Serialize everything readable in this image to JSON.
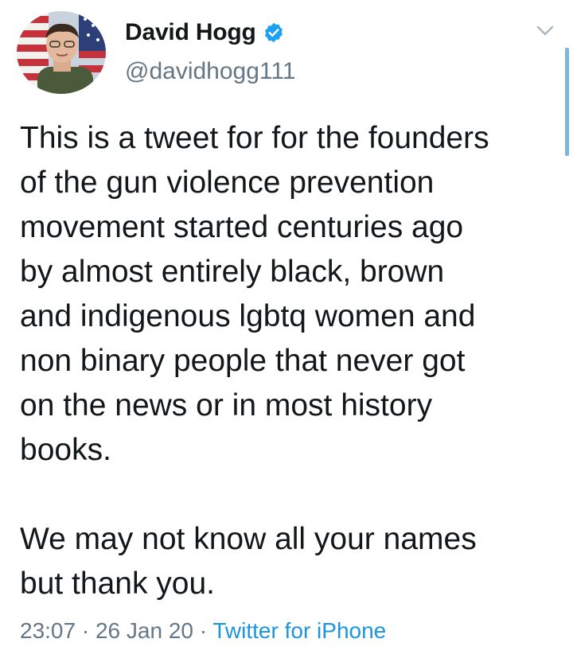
{
  "author": {
    "display_name": "David Hogg",
    "handle": "@davidhogg111",
    "verified": true,
    "avatar_icon": "profile-photo-with-flag"
  },
  "tweet": {
    "text": "This is a tweet for for the founders\nof the gun violence prevention\nmovement started centuries ago\nby almost entirely black, brown\nand indigenous lgbtq women and\nnon binary people that never got\non the news or in most history\nbooks.\n\nWe may not know all your names\nbut thank you.",
    "time": "23:07",
    "separator": " · ",
    "date": "26 Jan 20",
    "source": "Twitter for iPhone"
  },
  "icons": {
    "verified": "verified-badge-icon",
    "caret": "chevron-down-icon"
  },
  "colors": {
    "text": "#14171a",
    "secondary": "#657786",
    "link": "#1b95e0",
    "verified": "#1da1f2"
  }
}
